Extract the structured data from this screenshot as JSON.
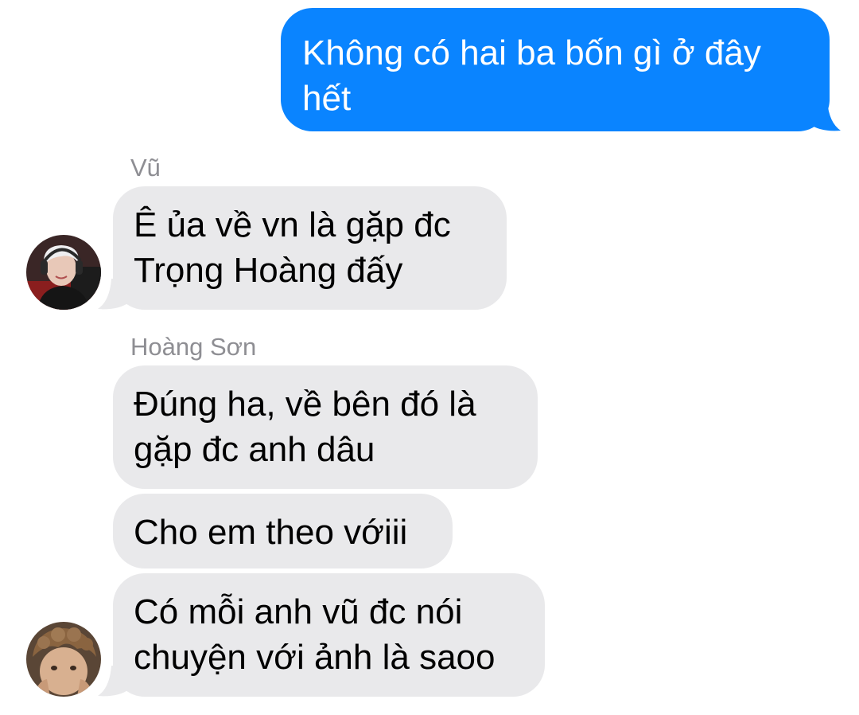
{
  "conversation": {
    "outgoing": [
      {
        "text": "Không có hai ba bốn gì ở đây\nhết"
      }
    ],
    "groups": [
      {
        "sender": "Vũ",
        "avatar_icon": "person-with-headset-avatar",
        "messages": [
          {
            "text": "Ê ủa về vn là gặp đc\nTrọng Hoàng đấy"
          }
        ]
      },
      {
        "sender": "Hoàng Sơn",
        "avatar_icon": "curly-hair-person-avatar",
        "messages": [
          {
            "text": "Đúng ha, về bên đó là\ngặp đc anh dâu"
          },
          {
            "text": "Cho em theo vớiii"
          },
          {
            "text": "Có mỗi anh vũ đc nói\nchuyện với ảnh là saoo"
          }
        ]
      }
    ]
  },
  "colors": {
    "outgoing_bubble": "#0a84ff",
    "incoming_bubble": "#e9e9eb",
    "sender_name": "#8e8e93"
  }
}
